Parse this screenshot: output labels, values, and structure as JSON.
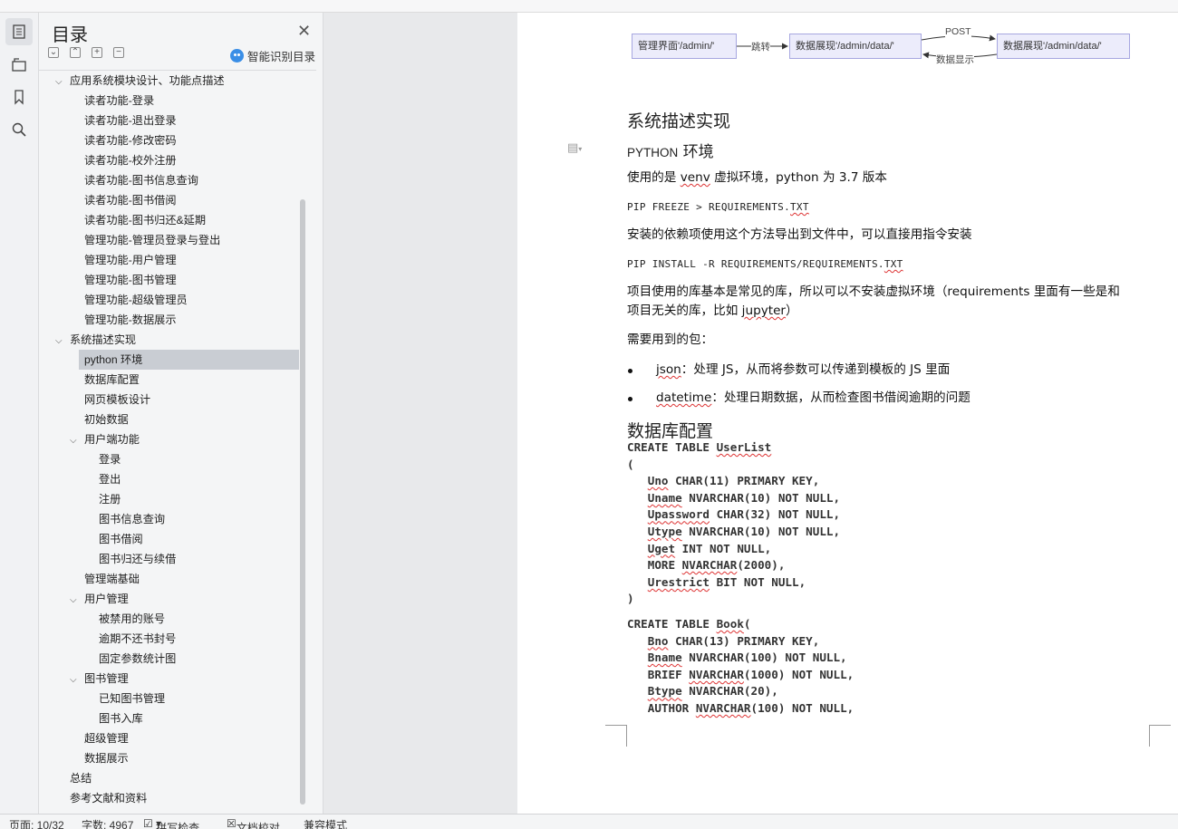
{
  "toc": {
    "title": "目录",
    "smart_label": "智能识别目录",
    "items": [
      {
        "label": "应用系统模块设计、功能点描述",
        "level": 1,
        "chevron": true,
        "selected": false
      },
      {
        "label": "读者功能-登录",
        "level": 2,
        "chevron": false,
        "selected": false
      },
      {
        "label": "读者功能-退出登录",
        "level": 2,
        "chevron": false,
        "selected": false
      },
      {
        "label": "读者功能-修改密码",
        "level": 2,
        "chevron": false,
        "selected": false
      },
      {
        "label": "读者功能-校外注册",
        "level": 2,
        "chevron": false,
        "selected": false
      },
      {
        "label": "读者功能-图书信息查询",
        "level": 2,
        "chevron": false,
        "selected": false
      },
      {
        "label": "读者功能-图书借阅",
        "level": 2,
        "chevron": false,
        "selected": false
      },
      {
        "label": "读者功能-图书归还&延期",
        "level": 2,
        "chevron": false,
        "selected": false
      },
      {
        "label": "管理功能-管理员登录与登出",
        "level": 2,
        "chevron": false,
        "selected": false
      },
      {
        "label": "管理功能-用户管理",
        "level": 2,
        "chevron": false,
        "selected": false
      },
      {
        "label": "管理功能-图书管理",
        "level": 2,
        "chevron": false,
        "selected": false
      },
      {
        "label": "管理功能-超级管理员",
        "level": 2,
        "chevron": false,
        "selected": false
      },
      {
        "label": "管理功能-数据展示",
        "level": 2,
        "chevron": false,
        "selected": false
      },
      {
        "label": "系统描述实现",
        "level": 1,
        "chevron": true,
        "selected": false
      },
      {
        "label": "python 环境",
        "level": 2,
        "chevron": false,
        "selected": true
      },
      {
        "label": "数据库配置",
        "level": 2,
        "chevron": false,
        "selected": false
      },
      {
        "label": "网页模板设计",
        "level": 2,
        "chevron": false,
        "selected": false
      },
      {
        "label": "初始数据",
        "level": 2,
        "chevron": false,
        "selected": false
      },
      {
        "label": "用户端功能",
        "level": 2,
        "chevron": true,
        "selected": false
      },
      {
        "label": "登录",
        "level": 3,
        "chevron": false,
        "selected": false
      },
      {
        "label": "登出",
        "level": 3,
        "chevron": false,
        "selected": false
      },
      {
        "label": "注册",
        "level": 3,
        "chevron": false,
        "selected": false
      },
      {
        "label": "图书信息查询",
        "level": 3,
        "chevron": false,
        "selected": false
      },
      {
        "label": "图书借阅",
        "level": 3,
        "chevron": false,
        "selected": false
      },
      {
        "label": "图书归还与续借",
        "level": 3,
        "chevron": false,
        "selected": false
      },
      {
        "label": "管理端基础",
        "level": 2,
        "chevron": false,
        "selected": false
      },
      {
        "label": "用户管理",
        "level": 2,
        "chevron": true,
        "selected": false
      },
      {
        "label": "被禁用的账号",
        "level": 3,
        "chevron": false,
        "selected": false
      },
      {
        "label": "逾期不还书封号",
        "level": 3,
        "chevron": false,
        "selected": false
      },
      {
        "label": "固定参数统计图",
        "level": 3,
        "chevron": false,
        "selected": false
      },
      {
        "label": "图书管理",
        "level": 2,
        "chevron": true,
        "selected": false
      },
      {
        "label": "已知图书管理",
        "level": 3,
        "chevron": false,
        "selected": false
      },
      {
        "label": "图书入库",
        "level": 3,
        "chevron": false,
        "selected": false
      },
      {
        "label": "超级管理",
        "level": 2,
        "chevron": false,
        "selected": false
      },
      {
        "label": "数据展示",
        "level": 2,
        "chevron": false,
        "selected": false
      },
      {
        "label": "总结",
        "level": 1,
        "chevron": false,
        "selected": false
      },
      {
        "label": "参考文献和资料",
        "level": 1,
        "chevron": false,
        "selected": false
      }
    ]
  },
  "diagram": {
    "box1": "管理界面'/admin/'",
    "box2": "数据展现'/admin/data/'",
    "box3": "数据展现'/admin/data/'",
    "edge1": "跳转",
    "edge2": "POST",
    "edge3": "数据显示"
  },
  "doc": {
    "h_system": "系统描述实现",
    "h_python_caps": "PYTHON",
    "h_python_rest": " 环境",
    "p_venv_1": "使用的是 ",
    "p_venv_word": "venv",
    "p_venv_2": " 虚拟环境，python 为 3.7 版本",
    "code1_a": "PIP FREEZE > REQUIREMENTS.",
    "code1_b": "TXT",
    "p_deps": "安装的依赖项使用这个方法导出到文件中，可以直接用指令安装",
    "code2_a": "PIP INSTALL -R REQUIREMENTS/REQUIREMENTS.",
    "code2_b": "TXT",
    "p_libs_1": "项目使用的库基本是常见的库，所以可以不安装虚拟环境（requirements 里面有一些是和",
    "p_libs_2a": "项目无关的库，比如 ",
    "p_libs_2w": "jupyter",
    "p_libs_2b": "）",
    "p_pkgs": "需要用到的包：",
    "b1_word": "json",
    "b1_text": "：处理 JS，从而将参数可以传递到模板的 JS 里面",
    "b2_word": "datetime",
    "b2_text": "：处理日期数据，从而检查图书借阅逾期的问题",
    "h_db": "数据库配置",
    "sql_userlist": [
      [
        "CREATE TABLE ",
        "UserList",
        ""
      ],
      [
        "(",
        "",
        ""
      ],
      [
        "   ",
        "Uno",
        " CHAR(11) PRIMARY KEY,"
      ],
      [
        "   ",
        "Uname",
        " NVARCHAR(10) NOT NULL,"
      ],
      [
        "   ",
        "Upassword",
        " CHAR(32) NOT NULL,"
      ],
      [
        "   ",
        "Utype",
        " NVARCHAR(10) NOT NULL,"
      ],
      [
        "   ",
        "Uget",
        " INT NOT NULL,"
      ],
      [
        "   MORE ",
        "NVARCHAR",
        "(2000),"
      ],
      [
        "   ",
        "Urestrict",
        " BIT NOT NULL,"
      ],
      [
        ")",
        "",
        ""
      ]
    ],
    "sql_book": [
      [
        "CREATE TABLE ",
        "Book",
        "("
      ],
      [
        "   ",
        "Bno",
        " CHAR(13) PRIMARY KEY,"
      ],
      [
        "   ",
        "Bname",
        " NVARCHAR(100) NOT NULL,"
      ],
      [
        "   BRIEF ",
        "NVARCHAR",
        "(1000) NOT NULL,"
      ],
      [
        "   ",
        "Btype",
        " NVARCHAR(20),"
      ],
      [
        "   AUTHOR ",
        "NVARCHAR",
        "(100) NOT NULL,"
      ]
    ]
  },
  "status": {
    "page": "页面: 10/32",
    "words": "字数: 4967",
    "spell": "拼写检查",
    "proof": "文档校对",
    "compat": "兼容模式"
  },
  "colors": {
    "selected_bg": "#c9cdd3",
    "diagram_box": "#ececfb",
    "accent": "#3a8ee6"
  }
}
